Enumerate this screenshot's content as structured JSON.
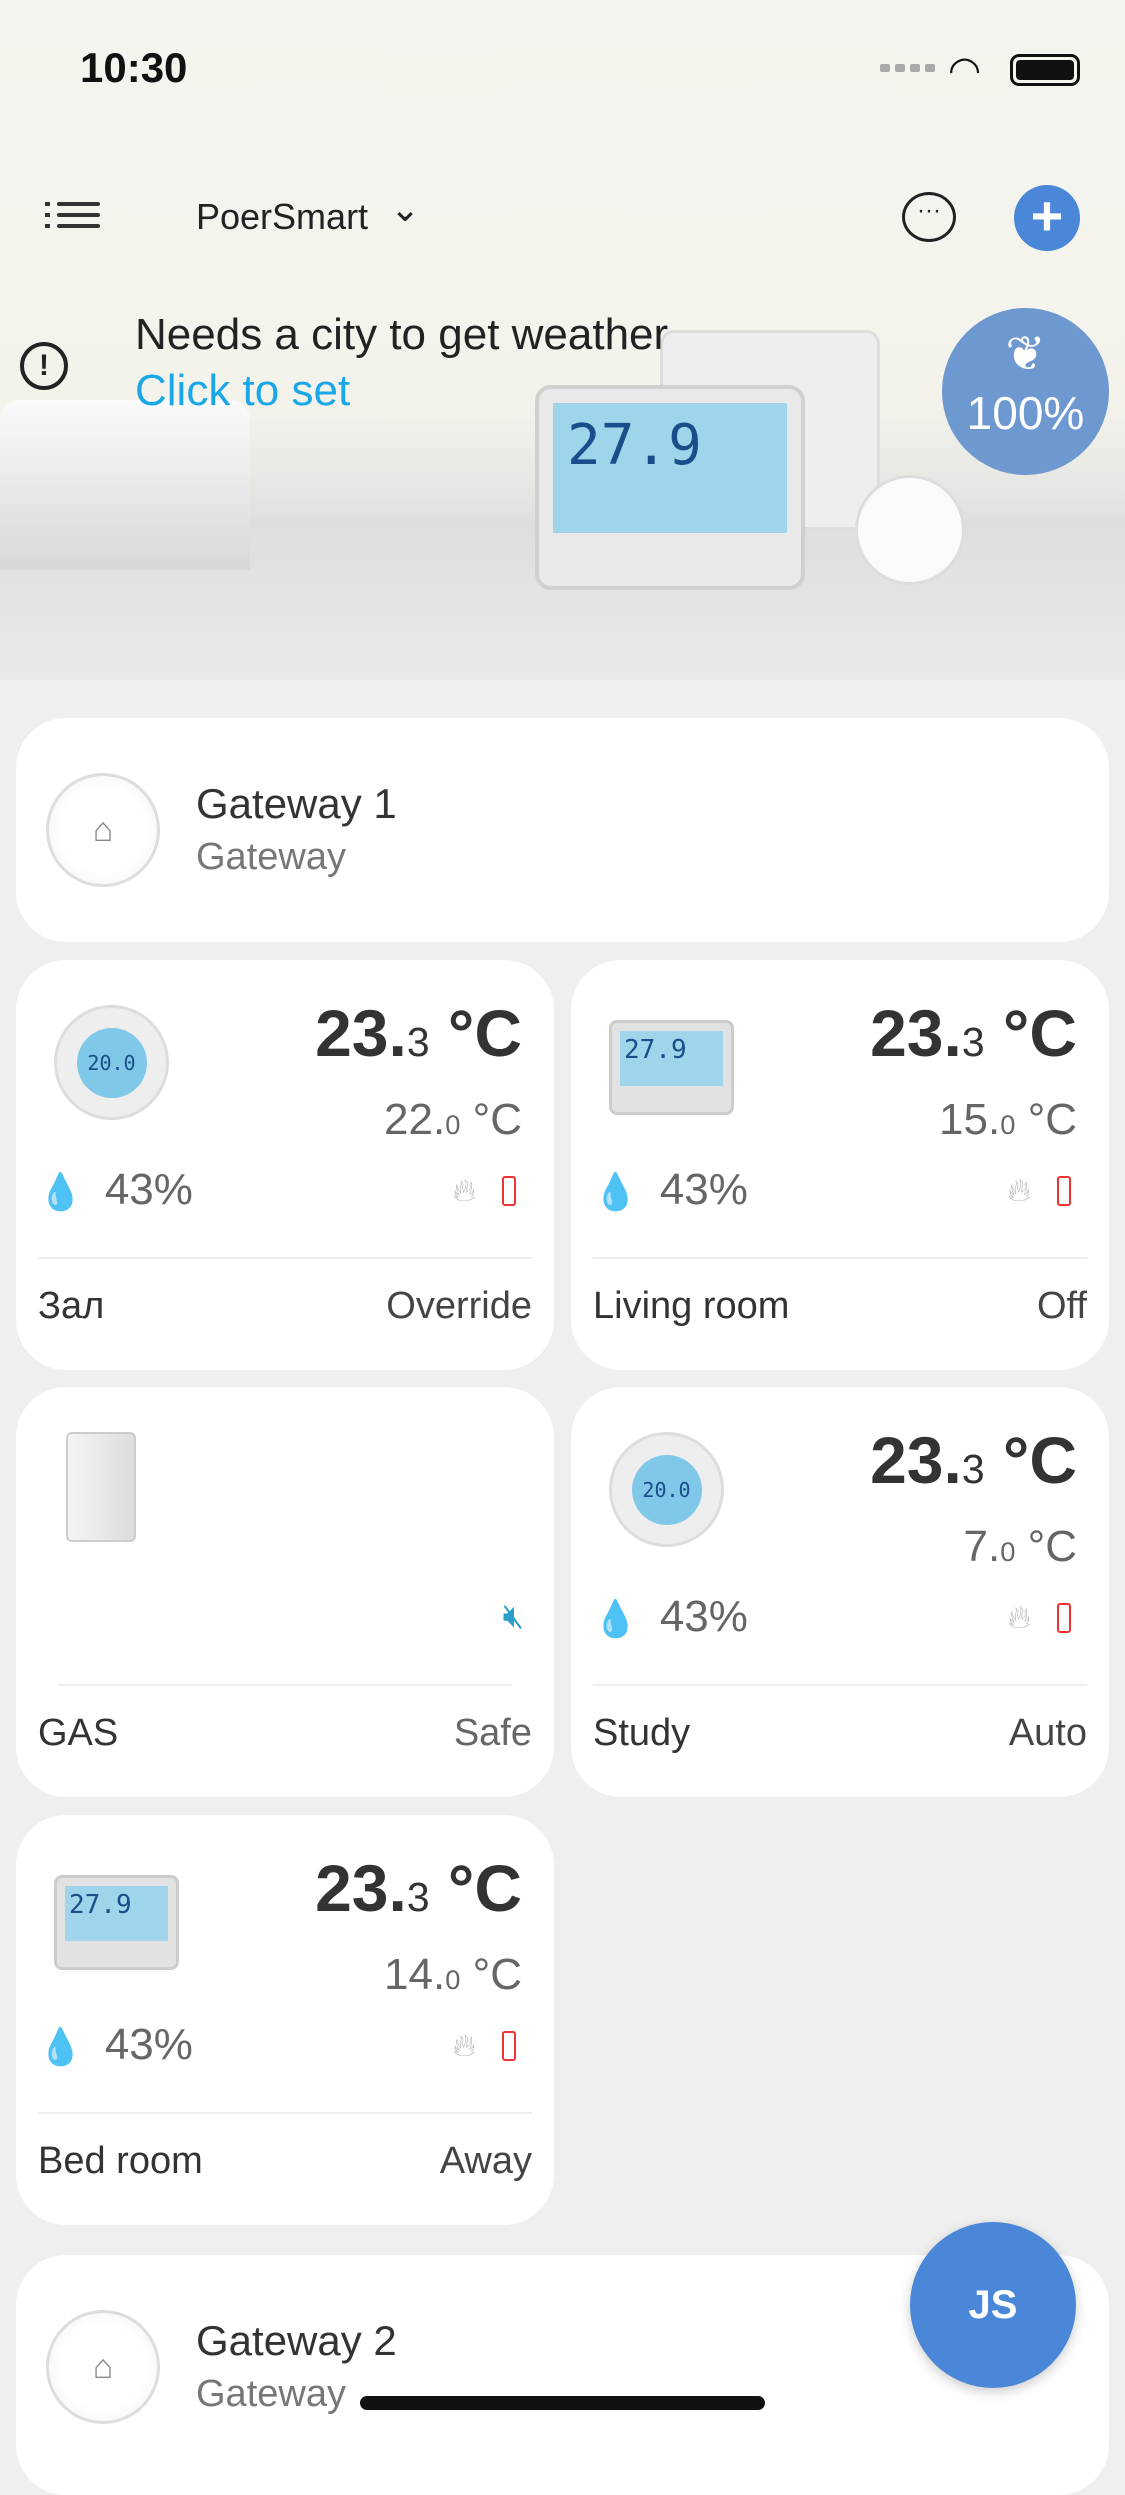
{
  "status_bar": {
    "time": "10:30"
  },
  "header": {
    "home_name": "PoerSmart",
    "menu_icon": "list-icon",
    "chat_icon": "chat-bubble-icon",
    "add_icon": "plus-icon"
  },
  "weather": {
    "message": "Needs a city to get weather",
    "link": "Click to set"
  },
  "eco": {
    "value": "100%",
    "icon": "sprout-icon"
  },
  "gateways": [
    {
      "name": "Gateway 1",
      "type": "Gateway"
    },
    {
      "name": "Gateway 2",
      "type": "Gateway"
    }
  ],
  "devices": [
    {
      "name": "Зал",
      "mode": "Override",
      "temp_int": "23.",
      "temp_dec": "3",
      "unit": " °C",
      "set_int": "22.",
      "set_dec": "0",
      "humidity": "43%"
    },
    {
      "name": "Living room",
      "mode": "Off",
      "temp_int": "23.",
      "temp_dec": "3",
      "unit": " °C",
      "set_int": "15.",
      "set_dec": "0",
      "humidity": "43%"
    },
    {
      "name": "GAS",
      "mode": "Safe"
    },
    {
      "name": "Study",
      "mode": "Auto",
      "temp_int": "23.",
      "temp_dec": "3",
      "unit": " °C",
      "set_int": "7.",
      "set_dec": "0",
      "humidity": "43%"
    },
    {
      "name": "Bed room",
      "mode": "Away",
      "temp_int": "23.",
      "temp_dec": "3",
      "unit": " °C",
      "set_int": "14.",
      "set_dec": "0",
      "humidity": "43%"
    }
  ],
  "fab": {
    "label": "JS"
  },
  "colors": {
    "accent": "#4a87d8",
    "link": "#1aa7e8",
    "battery_low": "#e33333",
    "humidity": "#2a96d6"
  }
}
